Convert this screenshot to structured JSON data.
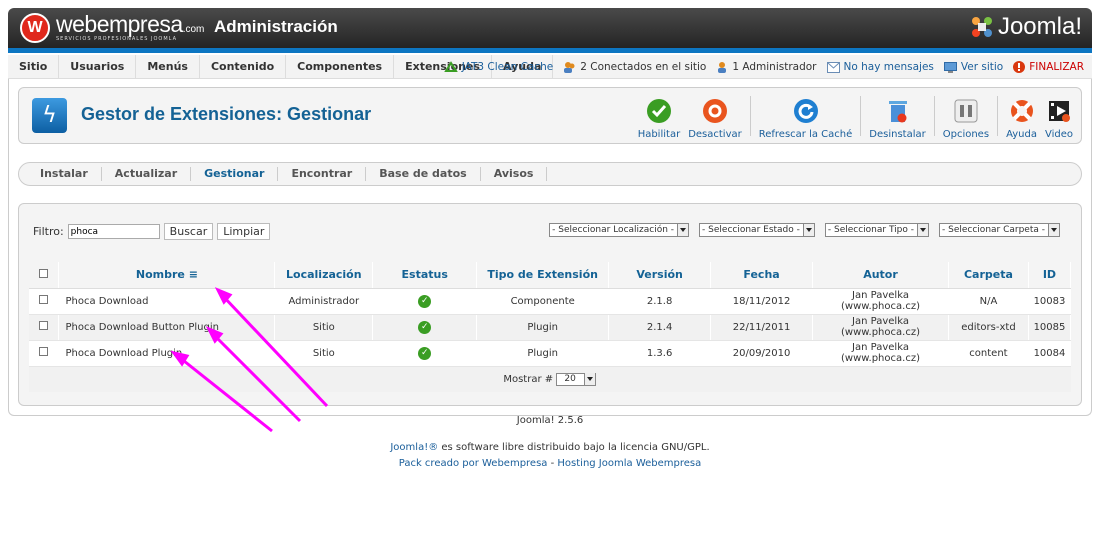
{
  "header": {
    "brand": "webempresa",
    "brand_suffix": ".com",
    "tagline": "SERVICIOS PROFESIONALES JOOMLA",
    "admin_title": "Administración",
    "cms_logo": "Joomla!"
  },
  "menu": {
    "items": [
      "Sitio",
      "Usuarios",
      "Menús",
      "Contenido",
      "Componentes",
      "Extensiones",
      "Ayuda"
    ]
  },
  "status": {
    "cache": "JAT3 Clean Cache",
    "connected": "2 Conectados en el sitio",
    "admins": "1 Administrador",
    "messages": "No hay mensajes",
    "view_site": "Ver sitio",
    "logout": "FINALIZAR"
  },
  "page": {
    "title": "Gestor de Extensiones: Gestionar"
  },
  "toolbar": {
    "enable": "Habilitar",
    "disable": "Desactivar",
    "refresh_cache": "Refrescar la Caché",
    "uninstall": "Desinstalar",
    "options": "Opciones",
    "help": "Ayuda",
    "video": "Video"
  },
  "tabs": [
    "Instalar",
    "Actualizar",
    "Gestionar",
    "Encontrar",
    "Base de datos",
    "Avisos"
  ],
  "filter": {
    "label": "Filtro:",
    "value": "phoca",
    "search_button": "Buscar",
    "clear_button": "Limpiar",
    "location_select": "- Seleccionar Localización -",
    "state_select": "- Seleccionar Estado -",
    "type_select": "- Seleccionar Tipo -",
    "folder_select": "- Seleccionar Carpeta -"
  },
  "table": {
    "columns": [
      "Nombre",
      "Localización",
      "Estatus",
      "Tipo de Extensión",
      "Versión",
      "Fecha",
      "Autor",
      "Carpeta",
      "ID"
    ],
    "rows": [
      {
        "name": "Phoca Download",
        "location": "Administrador",
        "type": "Componente",
        "version": "2.1.8",
        "date": "18/11/2012",
        "author": "Jan Pavelka (www.phoca.cz)",
        "folder": "N/A",
        "id": "10083"
      },
      {
        "name": "Phoca Download Button Plugin",
        "location": "Sitio",
        "type": "Plugin",
        "version": "2.1.4",
        "date": "22/11/2011",
        "author": "Jan Pavelka (www.phoca.cz)",
        "folder": "editors-xtd",
        "id": "10085"
      },
      {
        "name": "Phoca Download Plugin",
        "location": "Sitio",
        "type": "Plugin",
        "version": "1.3.6",
        "date": "20/09/2010",
        "author": "Jan Pavelka (www.phoca.cz)",
        "folder": "content",
        "id": "10084"
      }
    ],
    "limit_label": "Mostrar #",
    "limit_value": "20"
  },
  "footer": {
    "version": "Joomla! 2.5.6",
    "license_link": "Joomla!®",
    "license_text": " es software libre distribuido bajo la licencia GNU/GPL.",
    "pack_link1": "Pack creado por Webempresa",
    "pack_sep": " - ",
    "pack_link2": "Hosting Joomla Webempresa"
  },
  "colors": {
    "accent_blue": "#146295",
    "link_blue": "#1a5e9a",
    "status_green": "#3a9d23",
    "annotation_magenta": "#ff00ff"
  }
}
